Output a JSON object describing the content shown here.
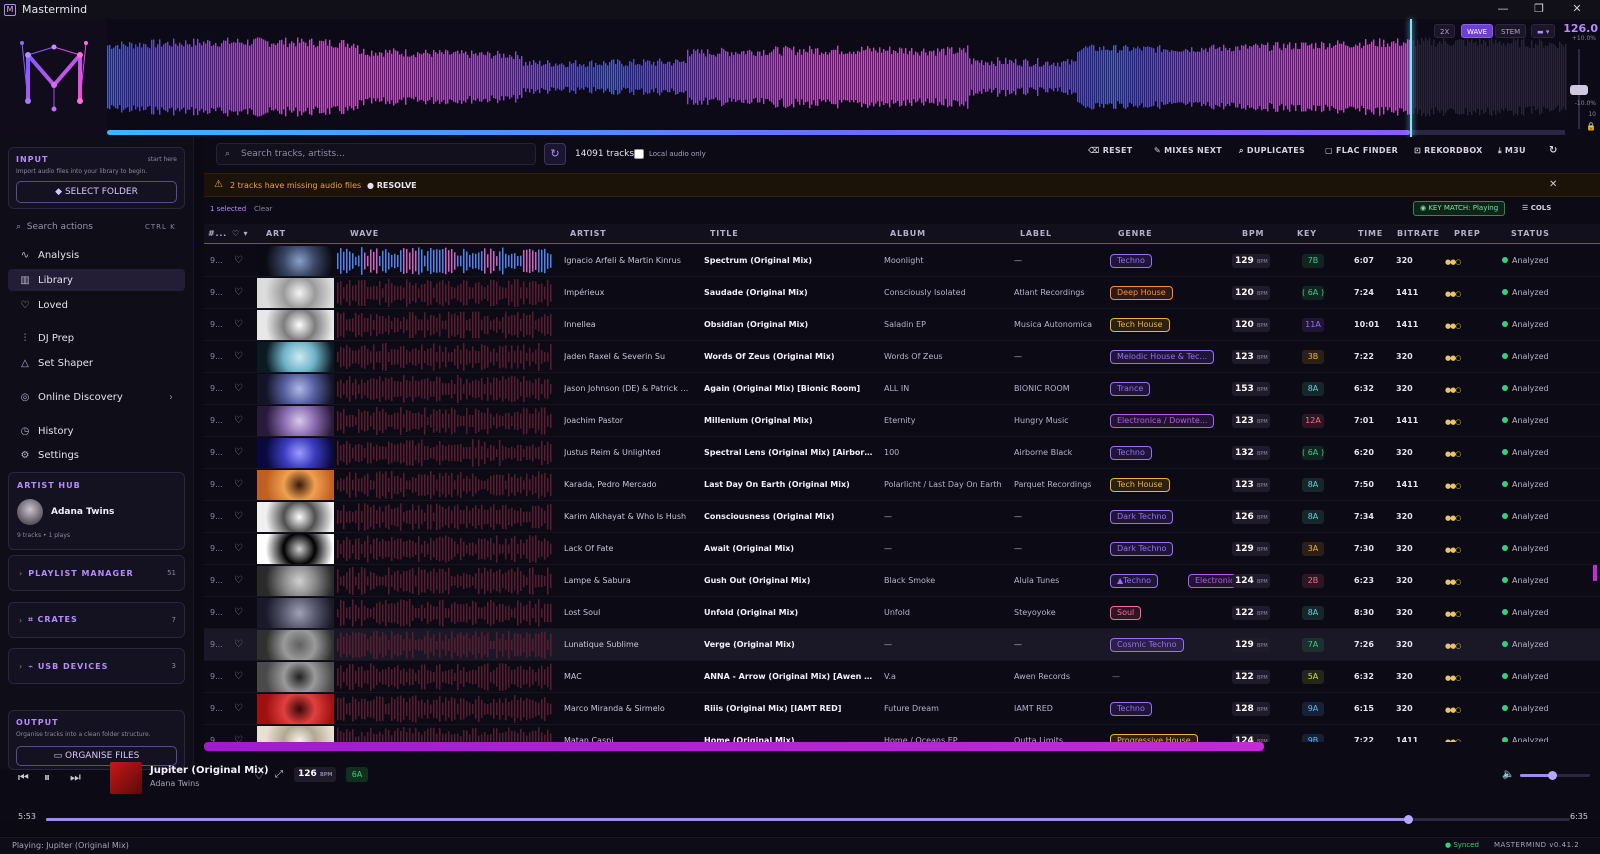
{
  "window": {
    "title": "Mastermind",
    "logo_letter": "M",
    "minimize": "—",
    "maximize": "❐",
    "close": "✕"
  },
  "hero": {
    "controls": [
      "2X",
      "WAVE",
      "STEM"
    ],
    "active_control": "WAVE",
    "tempo": "126.0",
    "tempo_top": "+10.0%",
    "tempo_bottom": "-10.0%",
    "tempo_range": "10",
    "lock_icon": "lock-icon",
    "playhead_fraction": 0.892
  },
  "sidebar": {
    "input": {
      "title": "INPUT",
      "hint": "start here",
      "desc": "Import audio files into your library to begin.",
      "button": "SELECT FOLDER"
    },
    "search": {
      "placeholder": "Search actions",
      "shortcut": "CTRL K"
    },
    "nav": [
      {
        "label": "Analysis",
        "icon": "waveform-icon"
      },
      {
        "label": "Library",
        "icon": "library-icon",
        "active": true
      },
      {
        "label": "Loved",
        "icon": "heart-icon"
      },
      {
        "label": "DJ Prep",
        "icon": "sliders-icon"
      },
      {
        "label": "Set Shaper",
        "icon": "triangle-icon"
      },
      {
        "label": "Online Discovery",
        "icon": "globe-icon",
        "chevron": "›"
      },
      {
        "label": "History",
        "icon": "clock-icon"
      },
      {
        "label": "Settings",
        "icon": "gear-icon"
      }
    ],
    "artist_hub": {
      "title": "ARTIST HUB",
      "artist": "Adana Twins",
      "meta": "9 tracks • 1 plays"
    },
    "playlist_manager": {
      "label": "PLAYLIST MANAGER",
      "count": "51"
    },
    "crates": {
      "label": "CRATES",
      "count": "7"
    },
    "usb_devices": {
      "label": "USB DEVICES",
      "count": "3"
    },
    "output": {
      "title": "OUTPUT",
      "desc": "Organise tracks into a clean folder structure.",
      "button": "ORGANISE FILES"
    }
  },
  "toolbar": {
    "search_placeholder": "Search tracks, artists...",
    "track_count": "14091 tracks",
    "local_only": "Local audio only",
    "reset": "RESET",
    "mixes_next": "MIXES NEXT",
    "duplicates": "DUPLICATES",
    "flac_finder": "FLAC FINDER",
    "rekordbox": "REKORDBOX",
    "m3u": "M3U"
  },
  "alert": {
    "text": "2 tracks have missing audio files",
    "action": "RESOLVE"
  },
  "selection": {
    "selected": "1 selected",
    "clear": "Clear",
    "key_match": "KEY MATCH: Playing",
    "cols": "COLS"
  },
  "columns": [
    "#...",
    "",
    "ART",
    "WAVE",
    "ARTIST",
    "TITLE",
    "ALBUM",
    "LABEL",
    "GENRE",
    "BPM",
    "KEY",
    "TIME",
    "BITRATE",
    "PREP",
    "STATUS"
  ],
  "genre_colors": {
    "Techno": "#9a6cff",
    "Deep House": "#ff8a3d",
    "Tech House": "#f2b233",
    "Melodic House & Tec...": "#9a6cff",
    "Trance": "#9a6cff",
    "Electronica / Downte...": "#b25cf0",
    "Dark Techno": "#9a6cff",
    "Soul": "#ff6b8a",
    "Cosmic Techno": "#9a6cff",
    "Progressive House": "#f2b233",
    "▲Techno": "#9a6cff",
    "Electronic": "#b25cf0"
  },
  "tracks": [
    {
      "num": "9...",
      "artist": "Ignacio Arfeli & Martin Kinrus",
      "title": "Spectrum (Original Mix)",
      "album": "Moonlight",
      "label": "—",
      "genres": [
        "Techno"
      ],
      "bpm": "129",
      "key": "7B",
      "time": "6:07",
      "bitrate": "320",
      "prep": "●●○",
      "status": "Analyzed",
      "art": [
        "#0a0a12",
        "#3a4766",
        "#8aa0c8"
      ]
    },
    {
      "num": "9...",
      "artist": "Impérieux",
      "title": "Saudade (Original Mix)",
      "album": "Consciously Isolated",
      "label": "Atlant Recordings",
      "genres": [
        "Deep House"
      ],
      "bpm": "120",
      "key": "( 6A )",
      "time": "7:24",
      "bitrate": "1411",
      "prep": "●●○",
      "status": "Analyzed",
      "art": [
        "#dcdcdc",
        "#9a9a9a",
        "#f4f4f4"
      ]
    },
    {
      "num": "9...",
      "artist": "Innellea",
      "title": "Obsidian (Original Mix)",
      "album": "Saladin EP",
      "label": "Musica Autonomica",
      "genres": [
        "Tech House"
      ],
      "bpm": "120",
      "key": "11A",
      "time": "10:01",
      "bitrate": "1411",
      "prep": "●●○",
      "status": "Analyzed",
      "art": [
        "#e8e8e8",
        "#7c7c7c",
        "#ffffff"
      ]
    },
    {
      "num": "9...",
      "artist": "Jaden Raxel & Severin Su",
      "title": "Words Of Zeus (Original Mix)",
      "album": "Words Of Zeus",
      "label": "—",
      "genres": [
        "Melodic House & Tec..."
      ],
      "bpm": "123",
      "key": "3B",
      "time": "7:22",
      "bitrate": "320",
      "prep": "●●○",
      "status": "Analyzed",
      "art": [
        "#0c1a22",
        "#6fb4c8",
        "#cfe9f2"
      ]
    },
    {
      "num": "9...",
      "artist": "Jason Johnson (DE) & Patrick Scuro",
      "title": "Again (Original Mix) [Bionic Room]",
      "album": "ALL IN",
      "label": "BIONIC ROOM",
      "genres": [
        "Trance"
      ],
      "bpm": "153",
      "key": "8A",
      "time": "6:32",
      "bitrate": "320",
      "prep": "●●○",
      "status": "Analyzed",
      "art": [
        "#141428",
        "#5660a0",
        "#b0b8e8"
      ]
    },
    {
      "num": "9...",
      "artist": "Joachim Pastor",
      "title": "Millenium (Original Mix)",
      "album": "Eternity",
      "label": "Hungry Music",
      "genres": [
        "Electronica / Downte..."
      ],
      "bpm": "123",
      "key": "12A",
      "time": "7:01",
      "bitrate": "1411",
      "prep": "●●○",
      "status": "Analyzed",
      "art": [
        "#2a1a3a",
        "#8a6cb0",
        "#d8c8ea"
      ]
    },
    {
      "num": "9...",
      "artist": "Justus Reim & Unlighted",
      "title": "Spectral Lens (Original Mix) [Airborne Black]",
      "album": "100",
      "label": "Airborne Black",
      "genres": [
        "Techno"
      ],
      "bpm": "132",
      "key": "( 6A )",
      "time": "6:20",
      "bitrate": "320",
      "prep": "●●○",
      "status": "Analyzed",
      "art": [
        "#0a0a40",
        "#3c3cc0",
        "#9c9cff"
      ]
    },
    {
      "num": "9...",
      "artist": "Karada, Pedro Mercado",
      "title": "Last Day On Earth (Original Mix)",
      "album": "Polarlicht / Last Day On Earth",
      "label": "Parquet Recordings",
      "genres": [
        "Tech House"
      ],
      "bpm": "123",
      "key": "8A",
      "time": "7:50",
      "bitrate": "1411",
      "prep": "●●○",
      "status": "Analyzed",
      "art": [
        "#c06020",
        "#f0a050",
        "#3a1a0a"
      ]
    },
    {
      "num": "9...",
      "artist": "Karim Alkhayat & Who Is Hush",
      "title": "Consciousness (Original Mix)",
      "album": "—",
      "label": "—",
      "genres": [
        "Dark Techno"
      ],
      "bpm": "126",
      "key": "8A",
      "time": "7:34",
      "bitrate": "320",
      "prep": "●●○",
      "status": "Analyzed",
      "art": [
        "#f0f0f0",
        "#505050",
        "#ffffff"
      ]
    },
    {
      "num": "9...",
      "artist": "Lack Of Fate",
      "title": "Await (Original Mix)",
      "album": "—",
      "label": "—",
      "genres": [
        "Dark Techno"
      ],
      "bpm": "129",
      "key": "3A",
      "time": "7:30",
      "bitrate": "320",
      "prep": "●●○",
      "status": "Analyzed",
      "art": [
        "#ffffff",
        "#000000",
        "#d0d0d0"
      ]
    },
    {
      "num": "9...",
      "artist": "Lampe & Sabura",
      "title": "Gush Out (Original Mix)",
      "album": "Black Smoke",
      "label": "Alula Tunes",
      "genres": [
        "▲Techno",
        "Electronic"
      ],
      "bpm": "124",
      "key": "2B",
      "time": "6:23",
      "bitrate": "320",
      "prep": "●●○",
      "status": "Analyzed",
      "art": [
        "#2a2a2a",
        "#8a8a8a",
        "#d0d0d0"
      ]
    },
    {
      "num": "9...",
      "artist": "Lost Soul",
      "title": "Unfold (Original Mix)",
      "album": "Unfold",
      "label": "Steyoyoke",
      "genres": [
        "Soul"
      ],
      "bpm": "122",
      "key": "8A",
      "time": "8:30",
      "bitrate": "320",
      "prep": "●●○",
      "status": "Analyzed",
      "art": [
        "#1a1a2a",
        "#5a5a70",
        "#a0a0b8"
      ]
    },
    {
      "num": "9...",
      "artist": "Lunatique Sublime",
      "title": "Verge (Original Mix)",
      "album": "—",
      "label": "—",
      "genres": [
        "Cosmic Techno"
      ],
      "bpm": "129",
      "key": "7A",
      "time": "7:26",
      "bitrate": "320",
      "prep": "●●○",
      "status": "Analyzed",
      "art": [
        "#303030",
        "#9a9a9a",
        "#606060"
      ],
      "highlight": true
    },
    {
      "num": "9...",
      "artist": "MAC",
      "title": "ANNA - Arrow (Original Mix) [Awen Records]",
      "album": "V.a",
      "label": "Awen Records",
      "genres": [],
      "genre_placeholder": "—",
      "bpm": "122",
      "key": "5A",
      "time": "6:32",
      "bitrate": "320",
      "prep": "●●○",
      "status": "Analyzed",
      "art": [
        "#4a4a4a",
        "#9a9a9a",
        "#202020"
      ]
    },
    {
      "num": "9...",
      "artist": "Marco Miranda & Sirmelo",
      "title": "Riiis (Original Mix) [IAMT RED]",
      "album": "Future Dream",
      "label": "IAMT RED",
      "genres": [
        "Techno"
      ],
      "bpm": "128",
      "key": "9A",
      "time": "6:15",
      "bitrate": "320",
      "prep": "●●○",
      "status": "Analyzed",
      "art": [
        "#a01010",
        "#e04040",
        "#3a0505"
      ]
    },
    {
      "num": "9...",
      "artist": "Matan Caspi",
      "title": "Home (Original Mix)",
      "album": "Home / Oceans EP",
      "label": "Outta Limits",
      "genres": [
        "Progressive House"
      ],
      "bpm": "124",
      "key": "9B",
      "time": "7:22",
      "bitrate": "1411",
      "prep": "●●○",
      "status": "Analyzed",
      "art": [
        "#e8e0d0",
        "#b0a890",
        "#f8f4ea"
      ]
    }
  ],
  "key_colors": {
    "7B": "#36d07a",
    "( 6A )": "#36d07a",
    "11A": "#9a6cff",
    "3B": "#f2b233",
    "8A": "#5fd8d0",
    "12A": "#ff6b8a",
    "3A": "#f2b233",
    "2B": "#ff6b8a",
    "7A": "#36d07a",
    "5A": "#c2e34a",
    "9A": "#5fb8ff",
    "9B": "#5fb8ff"
  },
  "player": {
    "title": "Jupiter (Original Mix)",
    "artist": "Adana Twins",
    "bpm": "126",
    "bpm_unit": "BPM",
    "key": "6A",
    "elapsed": "5:53",
    "total": "6:35",
    "progress": 0.894,
    "volume": 0.45
  },
  "statusbar": {
    "playing": "Playing: Jupiter (Original Mix)",
    "synced": "Synced",
    "version": "MASTERMIND v0.41.2"
  }
}
